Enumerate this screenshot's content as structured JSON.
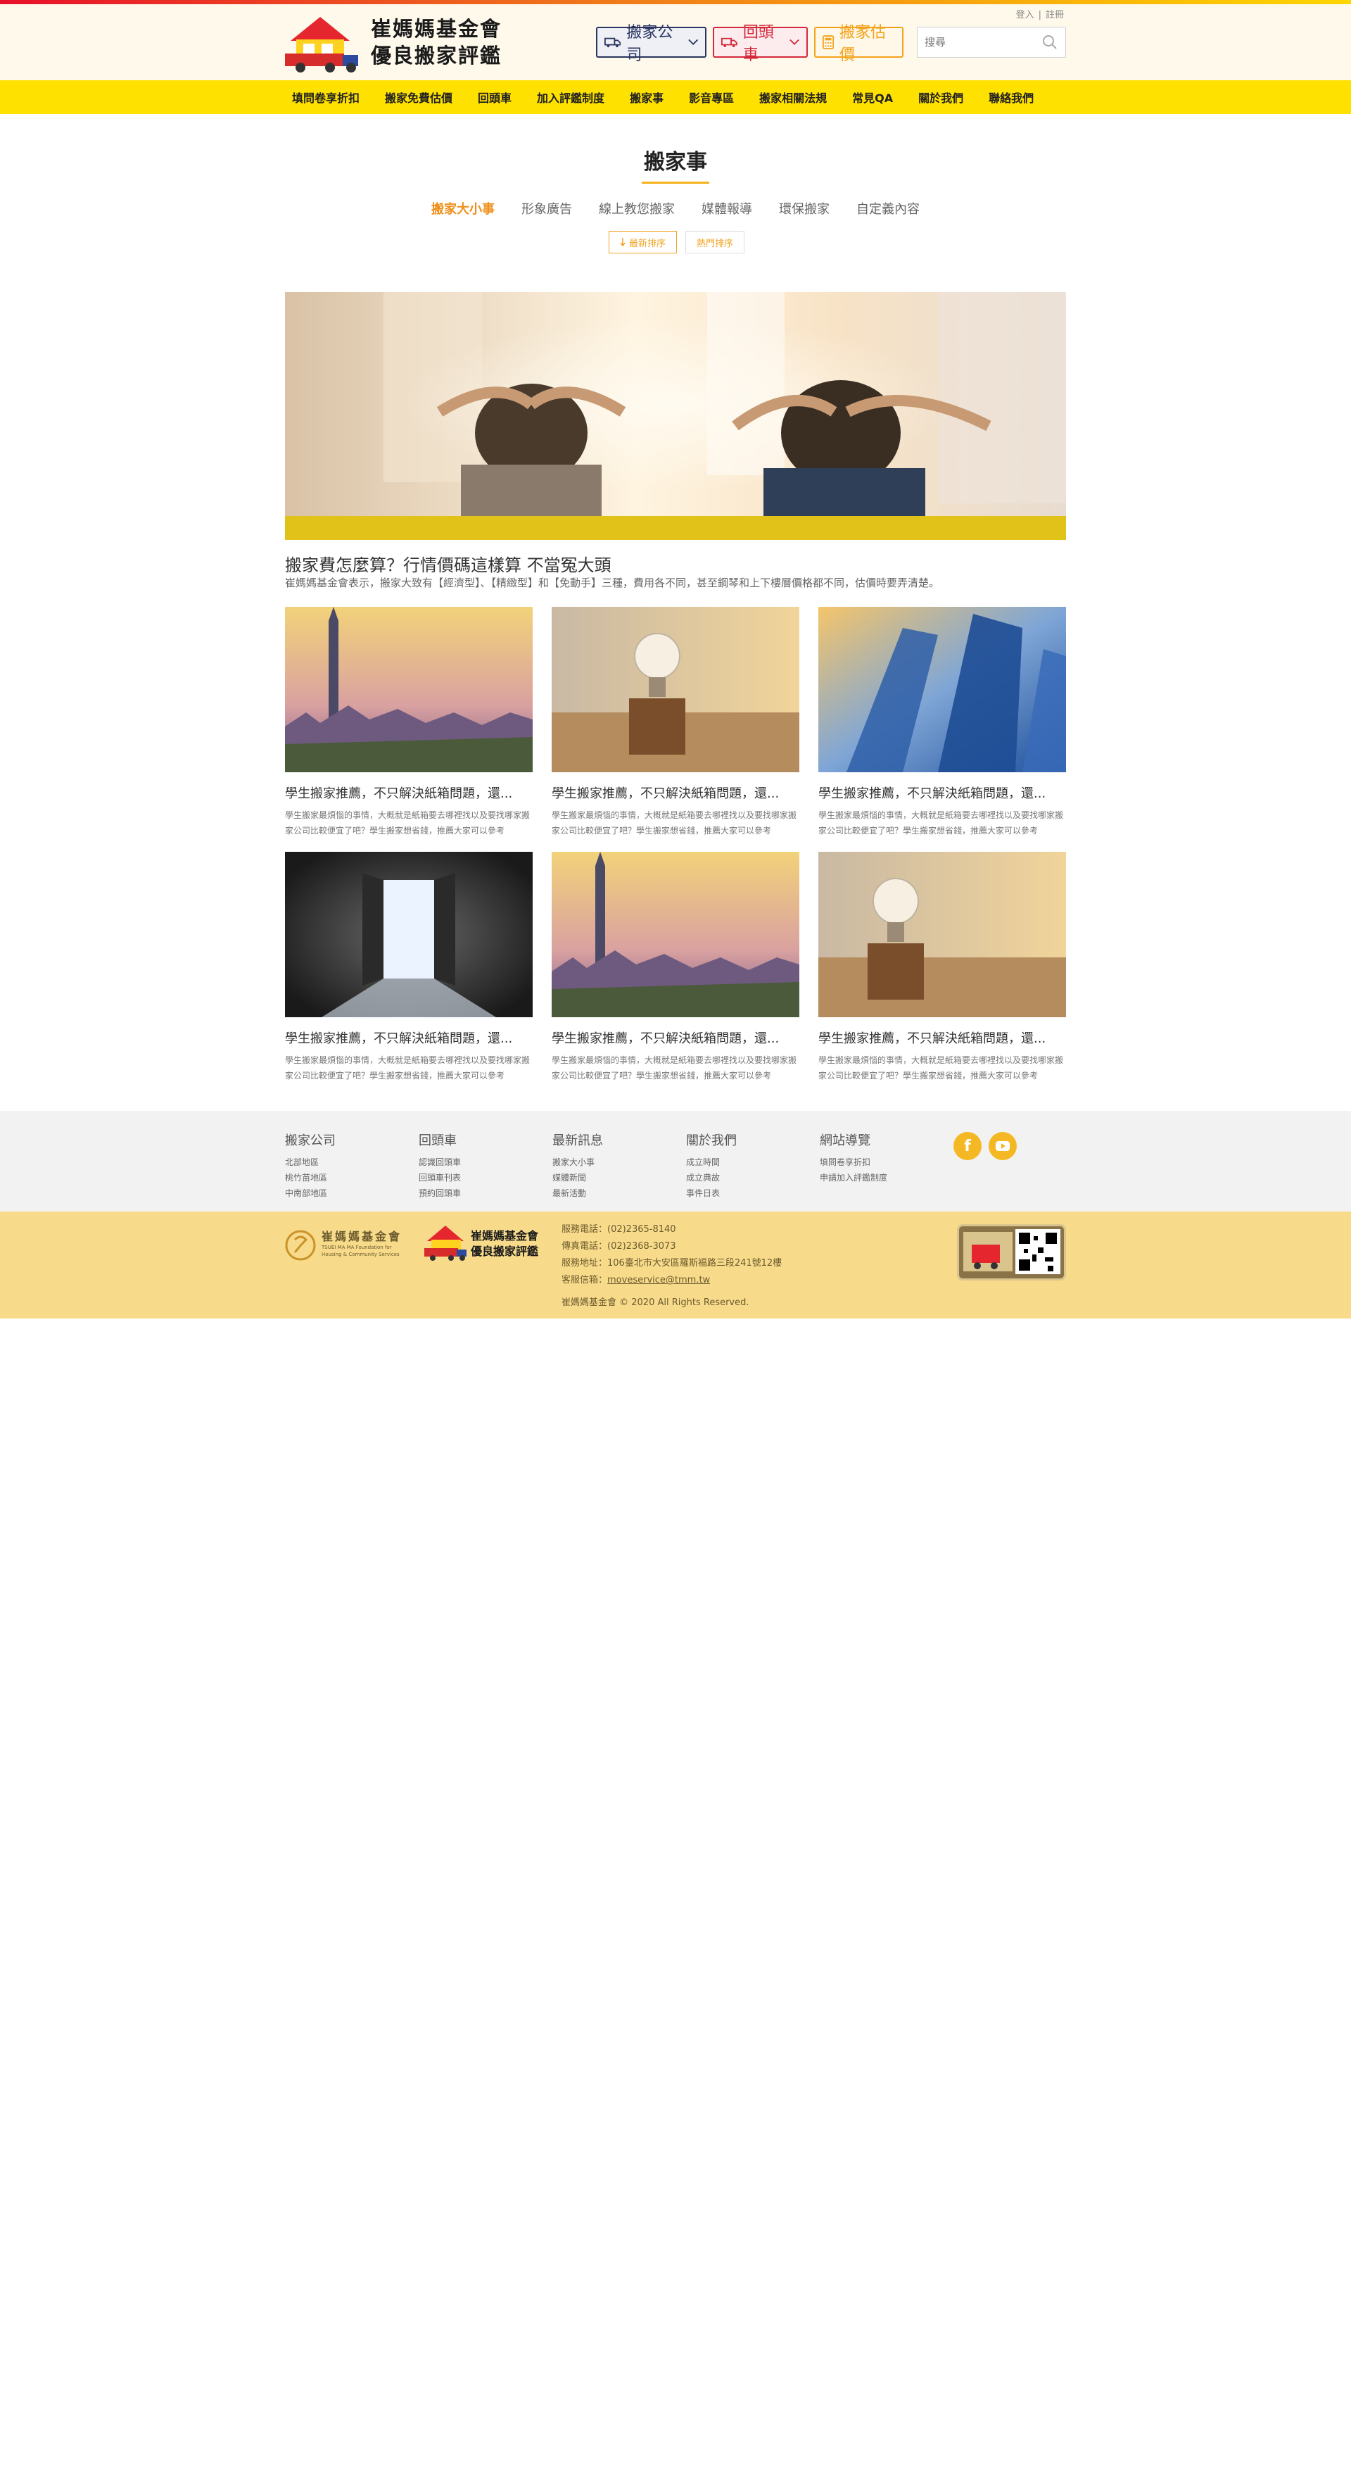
{
  "header": {
    "brand_line1": "崔媽媽基金會",
    "brand_line2": "優良搬家評鑑",
    "util_login": "登入",
    "util_sep": "|",
    "util_register": "註冊",
    "btn_moving_company": "搬家公司",
    "btn_return_truck": "回頭車",
    "btn_estimate": "搬家估價",
    "search_placeholder": "搜尋"
  },
  "nav": {
    "items": [
      "填問卷享折扣",
      "搬家免費估價",
      "回頭車",
      "加入評鑑制度",
      "搬家事",
      "影音專區",
      "搬家相關法規",
      "常見QA",
      "關於我們",
      "聯絡我們"
    ]
  },
  "main": {
    "title": "搬家事",
    "tabs": [
      "搬家大小事",
      "形象廣告",
      "線上教您搬家",
      "媒體報導",
      "環保搬家",
      "自定義內容"
    ],
    "sort_latest": "最新排序",
    "sort_popular": "熱門排序",
    "hero_title": "搬家費怎麼算？行情價碼這樣算 不當冤大頭",
    "hero_desc": "崔媽媽基金會表示，搬家大致有【經濟型】、【精緻型】和【免動手】三種，費用各不同，甚至鋼琴和上下樓層價格都不同，估價時要弄清楚。",
    "cards": [
      {
        "title": "學生搬家推薦，不只解決紙箱問題，還...",
        "desc": "學生搬家最煩惱的事情，大概就是紙箱要去哪裡找以及要找哪家搬家公司比較便宜了吧？學生搬家想省錢，推薦大家可以參考"
      },
      {
        "title": "學生搬家推薦，不只解決紙箱問題，還...",
        "desc": "學生搬家最煩惱的事情，大概就是紙箱要去哪裡找以及要找哪家搬家公司比較便宜了吧？學生搬家想省錢，推薦大家可以參考"
      },
      {
        "title": "學生搬家推薦，不只解決紙箱問題，還...",
        "desc": "學生搬家最煩惱的事情，大概就是紙箱要去哪裡找以及要找哪家搬家公司比較便宜了吧？學生搬家想省錢，推薦大家可以參考"
      },
      {
        "title": "學生搬家推薦，不只解決紙箱問題，還...",
        "desc": "學生搬家最煩惱的事情，大概就是紙箱要去哪裡找以及要找哪家搬家公司比較便宜了吧？學生搬家想省錢，推薦大家可以參考"
      },
      {
        "title": "學生搬家推薦，不只解決紙箱問題，還...",
        "desc": "學生搬家最煩惱的事情，大概就是紙箱要去哪裡找以及要找哪家搬家公司比較便宜了吧？學生搬家想省錢，推薦大家可以參考"
      },
      {
        "title": "學生搬家推薦，不只解決紙箱問題，還...",
        "desc": "學生搬家最煩惱的事情，大概就是紙箱要去哪裡找以及要找哪家搬家公司比較便宜了吧？學生搬家想省錢，推薦大家可以參考"
      }
    ]
  },
  "footer": {
    "cols": [
      {
        "title": "搬家公司",
        "links": [
          "北部地區",
          "桃竹苗地區",
          "中南部地區"
        ]
      },
      {
        "title": "回頭車",
        "links": [
          "認識回頭車",
          "回頭車刊表",
          "預約回頭車"
        ]
      },
      {
        "title": "最新訊息",
        "links": [
          "搬家大小事",
          "媒體新聞",
          "最新活動"
        ]
      },
      {
        "title": "關於我們",
        "links": [
          "成立時間",
          "成立典故",
          "事件日表"
        ]
      },
      {
        "title": "網站導覽",
        "links": [
          "填問卷享折扣",
          "申請加入評鑑制度"
        ]
      }
    ],
    "foundation_name": "崔媽媽基金會",
    "foundation_en": "TSUEI MA MA Foundation for Housing & Community Services",
    "service_phone": "服務電話：(02)2365-8140",
    "fax": "傳真電話：(02)2368-3073",
    "address": "服務地址：106臺北市大安區羅斯福路三段241號12樓",
    "email_label": "客服信箱：",
    "email": "moveservice@tmm.tw",
    "copyright": "崔媽媽基金會 © 2020 All Rights Reserved."
  },
  "colors": {
    "nav_bg": "#ffe100",
    "accent": "#ef8f1a",
    "footer_top_bg": "#f2f2f2",
    "footer_bottom_bg": "#f8db8a"
  }
}
